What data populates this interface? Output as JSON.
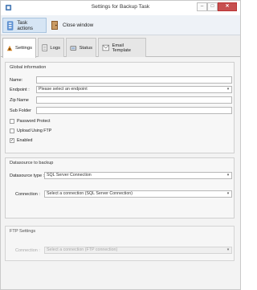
{
  "window": {
    "title": "Settings for Backup Task"
  },
  "titlebar": {
    "min_glyph": "–",
    "max_glyph": "□",
    "close_glyph": "✕"
  },
  "ribbon": {
    "task_actions": "Task actions",
    "close_window": "Close window"
  },
  "tabs": [
    {
      "label": "Settings",
      "icon": "settings-icon"
    },
    {
      "label": "Logs",
      "icon": "log-icon"
    },
    {
      "label": "Status",
      "icon": "status-icon"
    },
    {
      "label": "Email Template",
      "icon": "email-icon"
    }
  ],
  "global": {
    "title": "Global information",
    "name_label": "Name:",
    "endpoint_label": "Endpoint :",
    "endpoint_value": "Please select an endpoint",
    "zipname_label": "Zip Name",
    "subfolder_label": "Sub Folder",
    "password_protect": "Password Protect",
    "upload_ftp": "Upload Using FTP",
    "enabled": "Enabled",
    "enabled_checked": true
  },
  "datasource": {
    "title": "Datasource to backup",
    "type_label": "Datasource type :",
    "type_value": "SQL Server Connection",
    "connection_label": "Connection :",
    "connection_value": "Select a connection (SQL Server Connection)"
  },
  "ftp": {
    "title": "FTP Settings",
    "connection_label": "Connection :",
    "connection_value": "Select a connection (FTP connection)"
  },
  "check_glyph": "✓",
  "arrow_glyph": "▾"
}
